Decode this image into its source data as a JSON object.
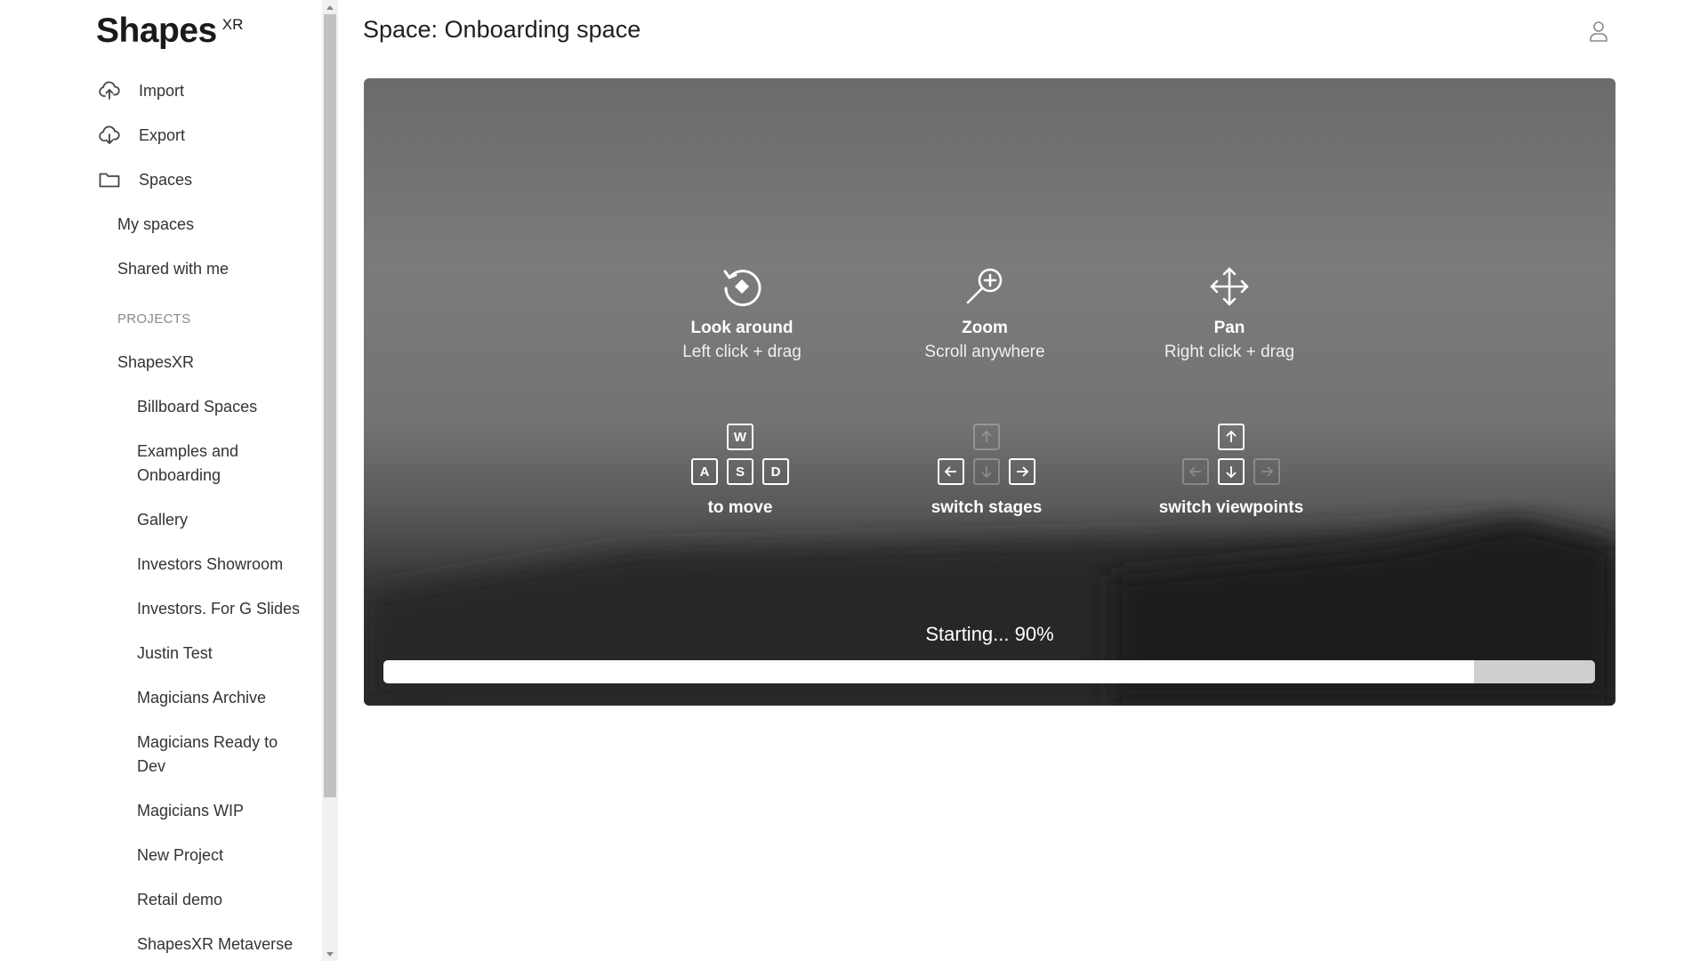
{
  "logo": {
    "word": "Shapes",
    "sup": "XR"
  },
  "sidebar": {
    "nav": [
      {
        "label": "Import",
        "icon": "cloud-upload-icon"
      },
      {
        "label": "Export",
        "icon": "cloud-download-icon"
      },
      {
        "label": "Spaces",
        "icon": "folder-icon"
      }
    ],
    "spaces": [
      "My spaces",
      "Shared with me"
    ],
    "projects_label": "PROJECTS",
    "project_root": "ShapesXR",
    "projects": [
      "Billboard Spaces",
      "Examples and Onboarding",
      "Gallery",
      "Investors Showroom",
      "Investors. For G Slides",
      "Justin Test",
      "Magicians Archive",
      "Magicians Ready to Dev",
      "Magicians WIP",
      "New Project",
      "Retail demo",
      "ShapesXR Metaverse"
    ]
  },
  "header": {
    "title": "Space: Onboarding space",
    "user_icon": "user-icon"
  },
  "viewer": {
    "controls": [
      {
        "title": "Look around",
        "desc": "Left click + drag",
        "icon": "rotate-icon"
      },
      {
        "title": "Zoom",
        "desc": "Scroll anywhere",
        "icon": "zoom-in-icon"
      },
      {
        "title": "Pan",
        "desc": "Right click + drag",
        "icon": "move-arrows-icon"
      }
    ],
    "keys": {
      "move": {
        "keys": [
          "W",
          "A",
          "S",
          "D"
        ],
        "caption": "to move"
      },
      "stages": {
        "caption": "switch stages"
      },
      "viewpoints": {
        "caption": "switch viewpoints"
      }
    },
    "loading": {
      "text": "Starting... 90%",
      "progress": 0.9
    }
  }
}
